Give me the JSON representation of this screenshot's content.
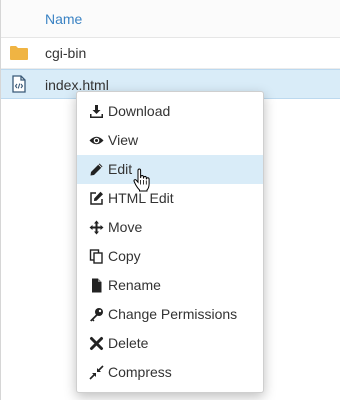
{
  "table": {
    "column_header": "Name"
  },
  "files": [
    {
      "name": "cgi-bin",
      "icon": "folder-icon",
      "selected": false
    },
    {
      "name": "index.html",
      "icon": "code-file-icon",
      "selected": true
    }
  ],
  "context_menu": {
    "items": [
      {
        "label": "Download",
        "icon": "download-icon"
      },
      {
        "label": "View",
        "icon": "eye-icon"
      },
      {
        "label": "Edit",
        "icon": "pencil-icon",
        "highlighted": true
      },
      {
        "label": "HTML Edit",
        "icon": "edit-square-icon"
      },
      {
        "label": "Move",
        "icon": "move-arrows-icon"
      },
      {
        "label": "Copy",
        "icon": "copy-icon"
      },
      {
        "label": "Rename",
        "icon": "file-icon"
      },
      {
        "label": "Change Permissions",
        "icon": "key-icon"
      },
      {
        "label": "Delete",
        "icon": "x-icon"
      },
      {
        "label": "Compress",
        "icon": "compress-icon"
      }
    ]
  },
  "colors": {
    "accent": "#3b83c4",
    "selected_row": "#d9ecf8",
    "folder": "#f0b443",
    "text": "#333333"
  }
}
